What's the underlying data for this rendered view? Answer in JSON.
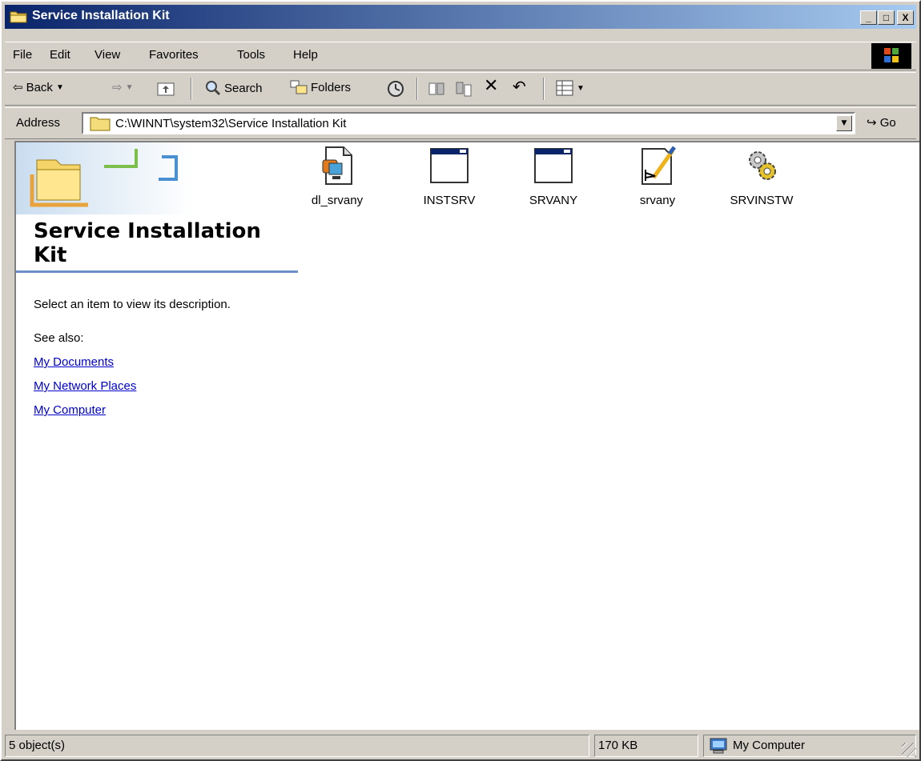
{
  "window": {
    "title": "Service Installation Kit",
    "controls": {
      "minimize": "_",
      "maximize": "□",
      "close": "X"
    }
  },
  "menubar": {
    "items": [
      "File",
      "Edit",
      "View",
      "Favorites",
      "Tools",
      "Help"
    ]
  },
  "toolbar": {
    "back_label": "Back",
    "search_label": "Search",
    "folders_label": "Folders"
  },
  "addressbar": {
    "label": "Address",
    "value": "C:\\WINNT\\system32\\Service Installation Kit",
    "go_label": "Go"
  },
  "sidebar": {
    "title": "Service Installation Kit",
    "description": "Select an item to view its description.",
    "see_also_label": "See also:",
    "links": [
      "My Documents",
      "My Network Places",
      "My Computer"
    ]
  },
  "files": [
    {
      "name": "dl_srvany",
      "icon": "document-exe-icon"
    },
    {
      "name": "INSTSRV",
      "icon": "application-window-icon"
    },
    {
      "name": "SRVANY",
      "icon": "application-window-icon"
    },
    {
      "name": "srvany",
      "icon": "wordpad-document-icon"
    },
    {
      "name": "SRVINSTW",
      "icon": "gears-icon"
    }
  ],
  "statusbar": {
    "objects": "5 object(s)",
    "size": "170 KB",
    "zone": "My Computer"
  }
}
